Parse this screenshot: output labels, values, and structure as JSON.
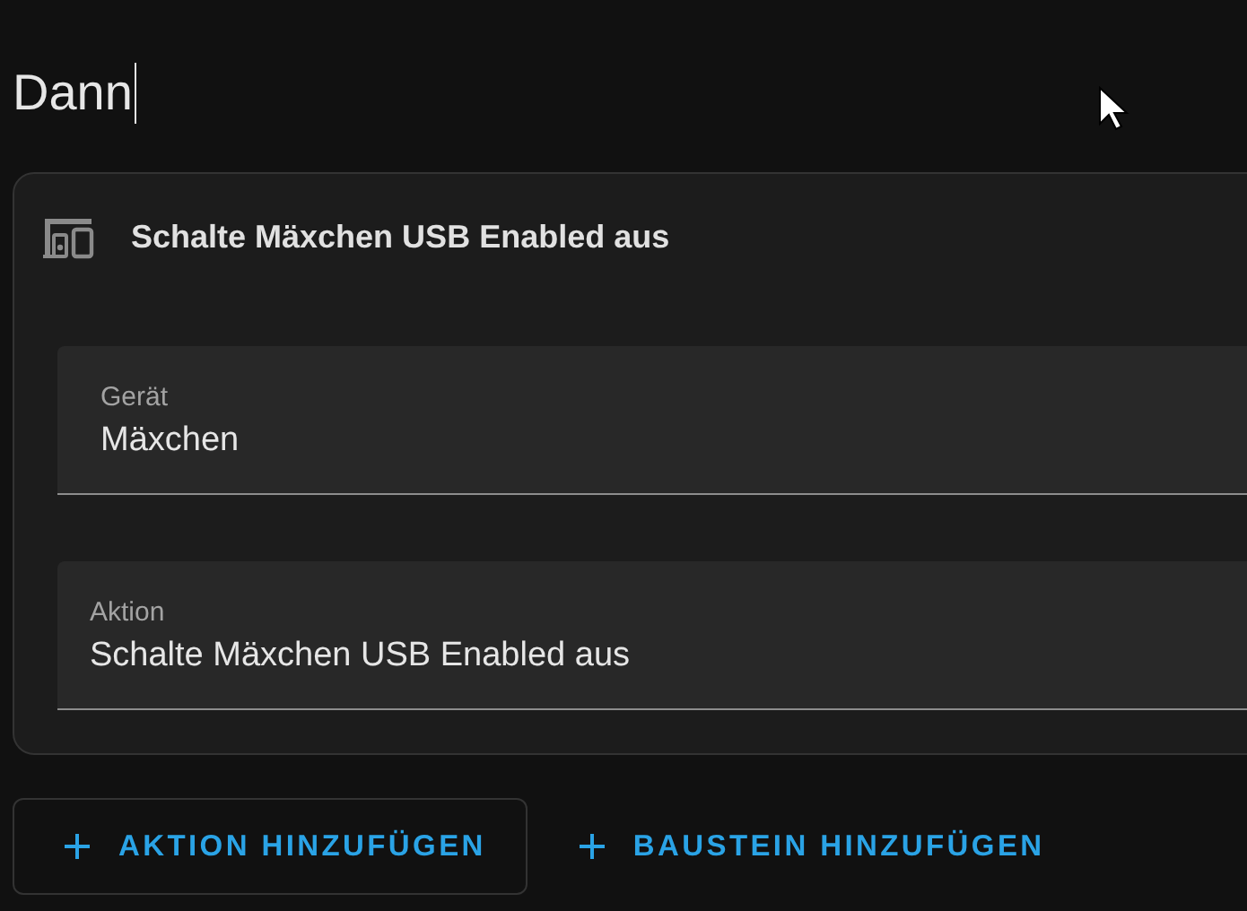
{
  "heading": "Dann",
  "card": {
    "title": "Schalte Mäxchen USB Enabled aus",
    "fields": [
      {
        "label": "Gerät",
        "value": "Mäxchen"
      },
      {
        "label": "Aktion",
        "value": "Schalte Mäxchen USB Enabled aus"
      }
    ]
  },
  "buttons": [
    {
      "label": "AKTION HINZUFÜGEN",
      "kind": "outlined"
    },
    {
      "label": "BAUSTEIN HINZUFÜGEN",
      "kind": "text"
    }
  ]
}
